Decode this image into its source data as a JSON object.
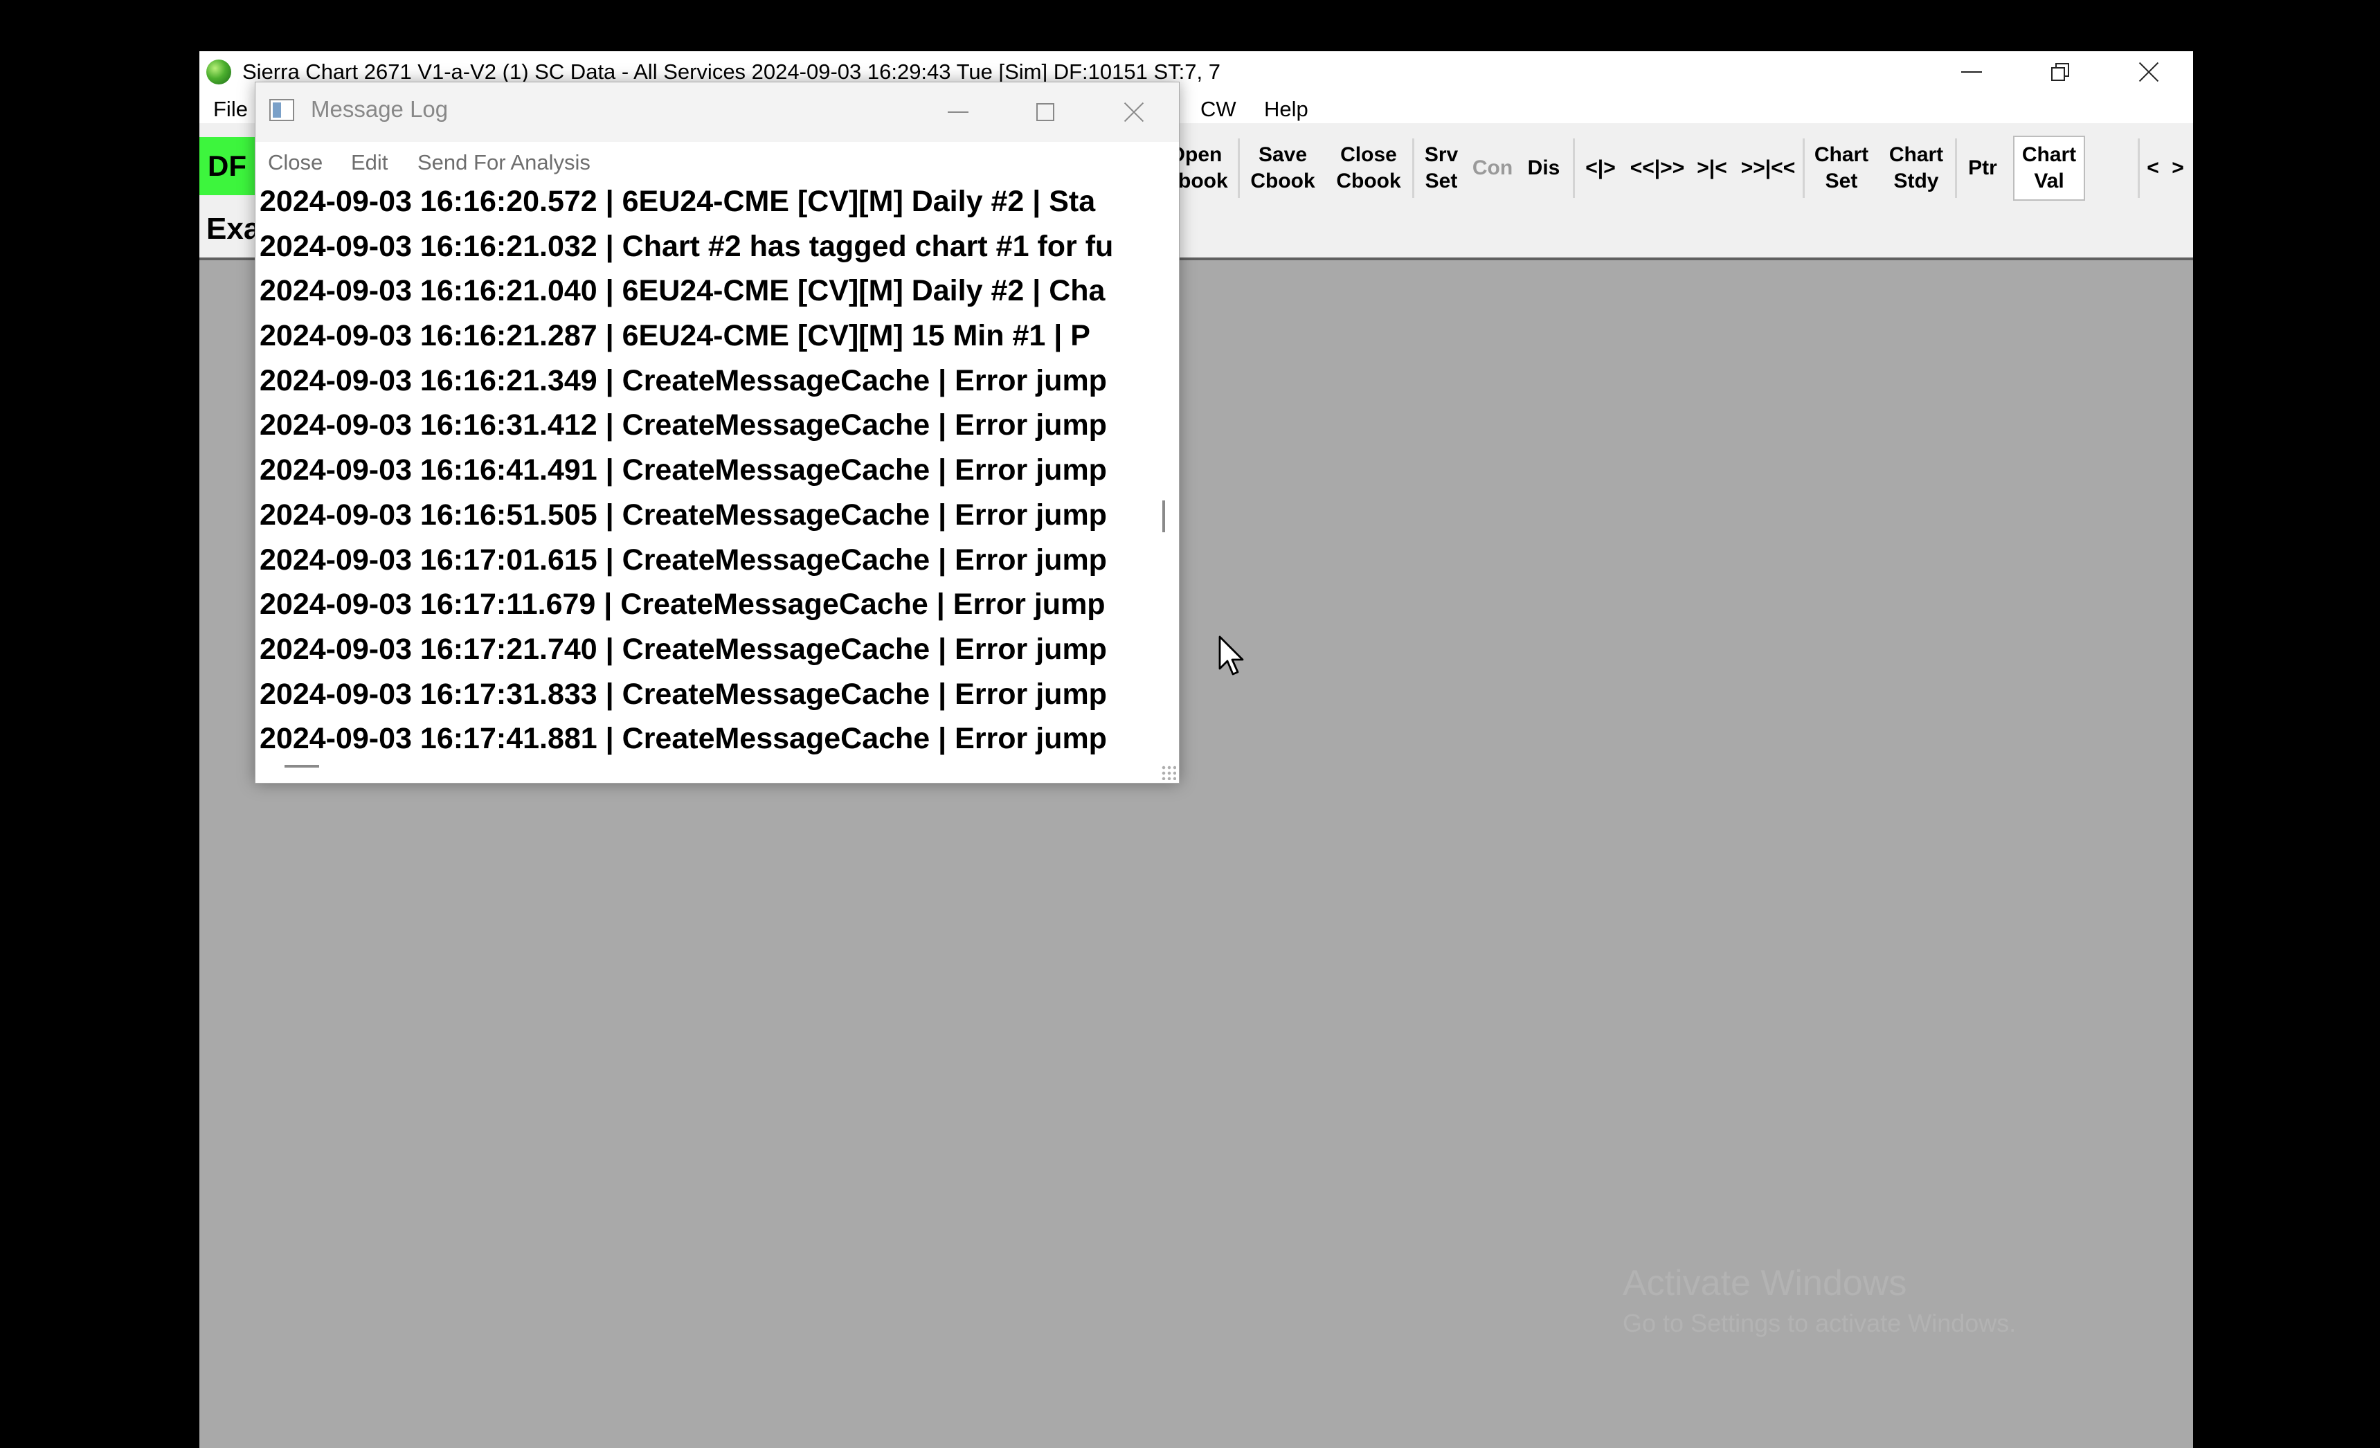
{
  "main_window": {
    "title": "Sierra Chart 2671 V1-a-V2 (1) SC Data - All Services 2024-09-03  16:29:43 Tue [Sim] DF:10151  ST:7, 7",
    "menu": {
      "file": "File",
      "cw": "CW",
      "help": "Help"
    },
    "df_indicator": "DF",
    "chart_name": "Exa",
    "toolbar": {
      "open_cbook": [
        "Open",
        "Cbook"
      ],
      "save_cbook": [
        "Save",
        "Cbook"
      ],
      "close_cbook": [
        "Close",
        "Cbook"
      ],
      "srv_set": [
        "Srv",
        "Set"
      ],
      "con": "Con",
      "dis": "Dis",
      "lt_bar_gt": "<|>",
      "ltlt_bar_gtgt": "<<|>>",
      "gt_bar_lt": ">|<",
      "gtgt_bar_ltlt": ">>|<<",
      "chart_set": [
        "Chart",
        "Set"
      ],
      "chart_stdy": [
        "Chart",
        "Stdy"
      ],
      "ptr": "Ptr",
      "chart_val": [
        "Chart",
        "Val"
      ],
      "scroll_left": "<",
      "scroll_right": ">"
    },
    "watermark": {
      "title": "Activate Windows",
      "line1": "Go to Settings to activate Windows.",
      "line2": ""
    }
  },
  "message_log": {
    "title": "Message Log",
    "menu": {
      "close": "Close",
      "edit": "Edit",
      "send_for_analysis": "Send For Analysis"
    },
    "lines": [
      "2024-09-03  16:16:20.572 | 6EU24-CME [CV][M]  Daily #2 | Sta",
      "2024-09-03  16:16:21.032 | Chart #2 has tagged chart #1 for fu",
      "2024-09-03  16:16:21.040 | 6EU24-CME [CV][M]  Daily #2 | Cha",
      "2024-09-03  16:16:21.287 | 6EU24-CME [CV][M]  15 Min  #1 | P",
      "2024-09-03  16:16:21.349 | CreateMessageCache | Error jump",
      "2024-09-03  16:16:31.412 | CreateMessageCache | Error jump",
      "2024-09-03  16:16:41.491 | CreateMessageCache | Error jump",
      "2024-09-03  16:16:51.505 | CreateMessageCache | Error jump",
      "2024-09-03  16:17:01.615 | CreateMessageCache | Error jump",
      "2024-09-03  16:17:11.679 | CreateMessageCache | Error jump",
      "2024-09-03  16:17:21.740 | CreateMessageCache | Error jump",
      "2024-09-03  16:17:31.833 | CreateMessageCache | Error jump",
      "2024-09-03  16:17:41.881 | CreateMessageCache | Error jump"
    ]
  },
  "colors": {
    "df_green": "#3df53d",
    "chart_bg": "#a9a9a9",
    "outer_bg": "#000000"
  }
}
